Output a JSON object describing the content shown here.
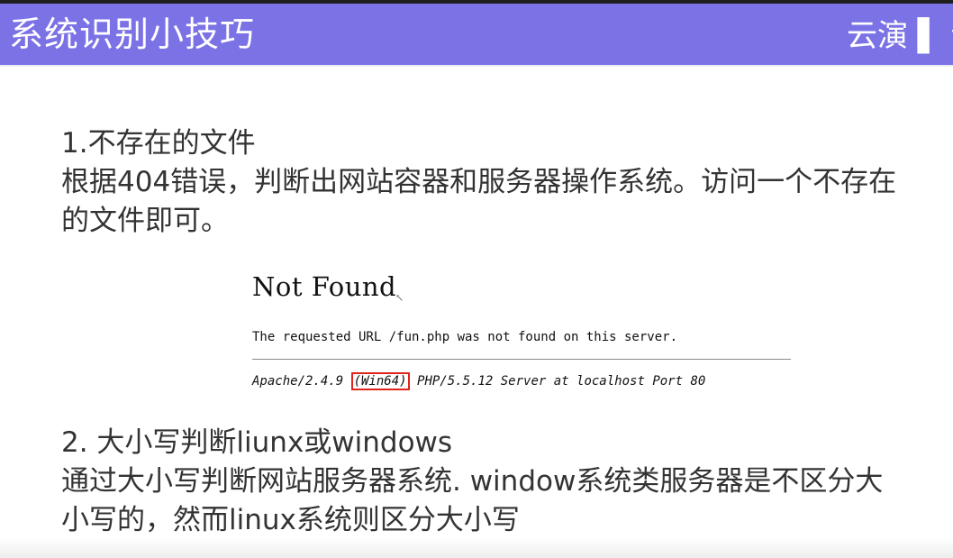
{
  "header": {
    "title": "系统识别小技巧",
    "brand": "云演 ▌ 讠"
  },
  "section1": {
    "heading": "1.不存在的文件",
    "line1": "根据404错误，判断出网站容器和服务器操作系统。访问一个不存在",
    "line2": "的文件即可。"
  },
  "figure": {
    "title": "Not Found",
    "message": "The requested URL /fun.php was not found on this server.",
    "footer_prefix": "Apache/2.4.9 ",
    "footer_highlight": "(Win64)",
    "footer_suffix": " PHP/5.5.12 Server at localhost Port 80",
    "highlight_color": "#e0231c"
  },
  "section2": {
    "heading": "2. 大小写判断liunx或windows",
    "line1": "通过大小写判断网站服务器系统. window系统类服务器是不区分大",
    "line2": "小写的，然而linux系统则区分大小写"
  },
  "colors": {
    "header_bg": "#7b72e6",
    "text": "#333333"
  }
}
